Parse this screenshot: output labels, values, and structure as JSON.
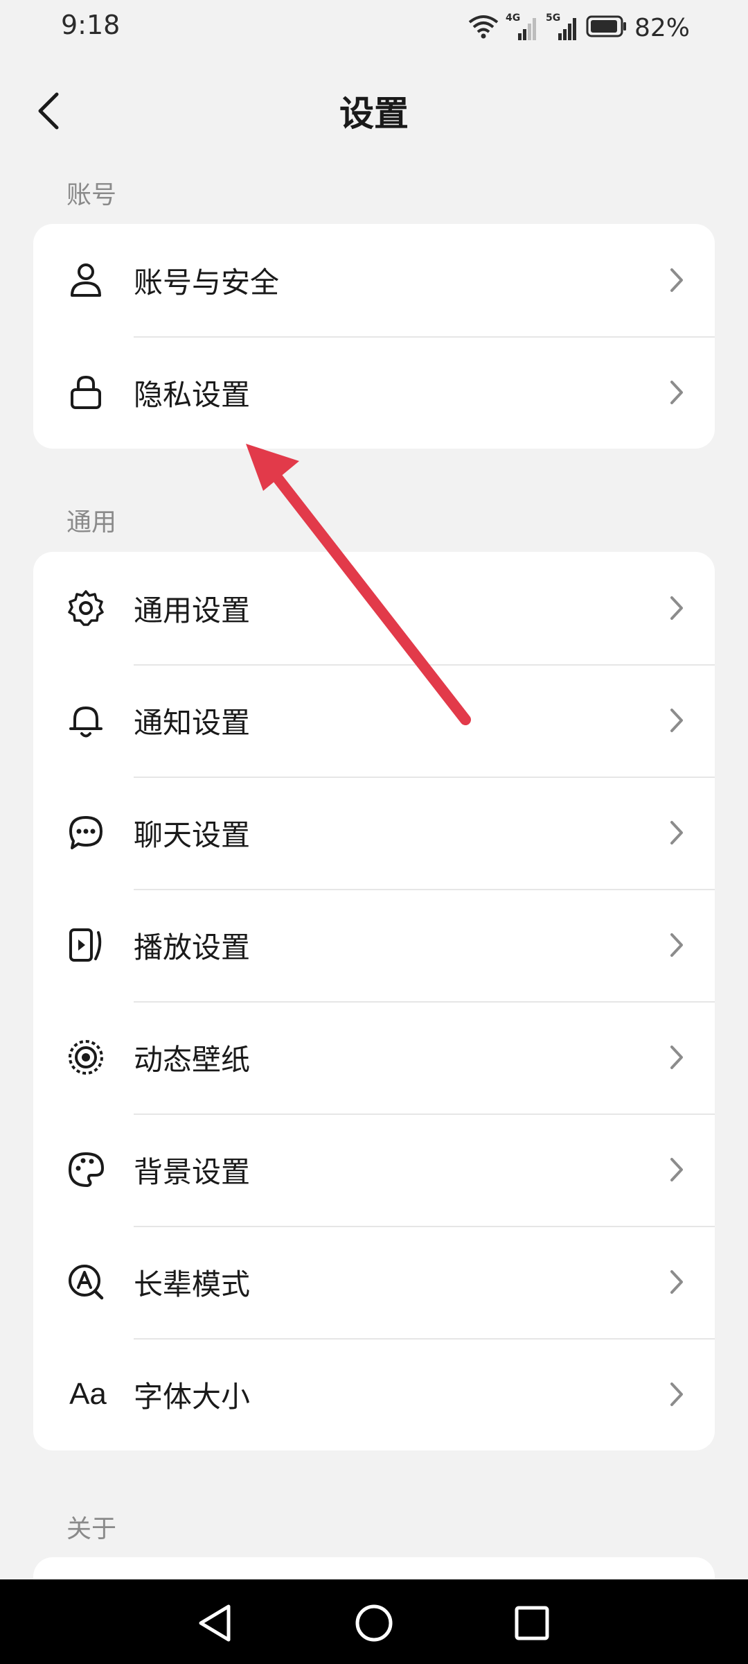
{
  "status_bar": {
    "time": "9:18",
    "network_1": "4G",
    "network_2": "5G",
    "battery": "82%"
  },
  "header": {
    "title": "设置",
    "back_icon": "back-arrow-icon"
  },
  "sections": {
    "account": {
      "label": "账号",
      "items": [
        {
          "label": "账号与安全",
          "icon": "person-icon"
        },
        {
          "label": "隐私设置",
          "icon": "lock-icon"
        }
      ]
    },
    "general": {
      "label": "通用",
      "items": [
        {
          "label": "通用设置",
          "icon": "gear-icon"
        },
        {
          "label": "通知设置",
          "icon": "bell-icon"
        },
        {
          "label": "聊天设置",
          "icon": "chat-icon"
        },
        {
          "label": "播放设置",
          "icon": "play-icon"
        },
        {
          "label": "动态壁纸",
          "icon": "wallpaper-icon"
        },
        {
          "label": "背景设置",
          "icon": "palette-icon"
        },
        {
          "label": "长辈模式",
          "icon": "elder-mode-icon"
        },
        {
          "label": "字体大小",
          "icon": "font-size-icon",
          "icon_text": "Aa"
        }
      ]
    },
    "about": {
      "label": "关于"
    }
  },
  "colors": {
    "background": "#f2f2f2",
    "card": "#ffffff",
    "annotation_arrow": "#e23a4a",
    "nav_bar": "#000000"
  }
}
